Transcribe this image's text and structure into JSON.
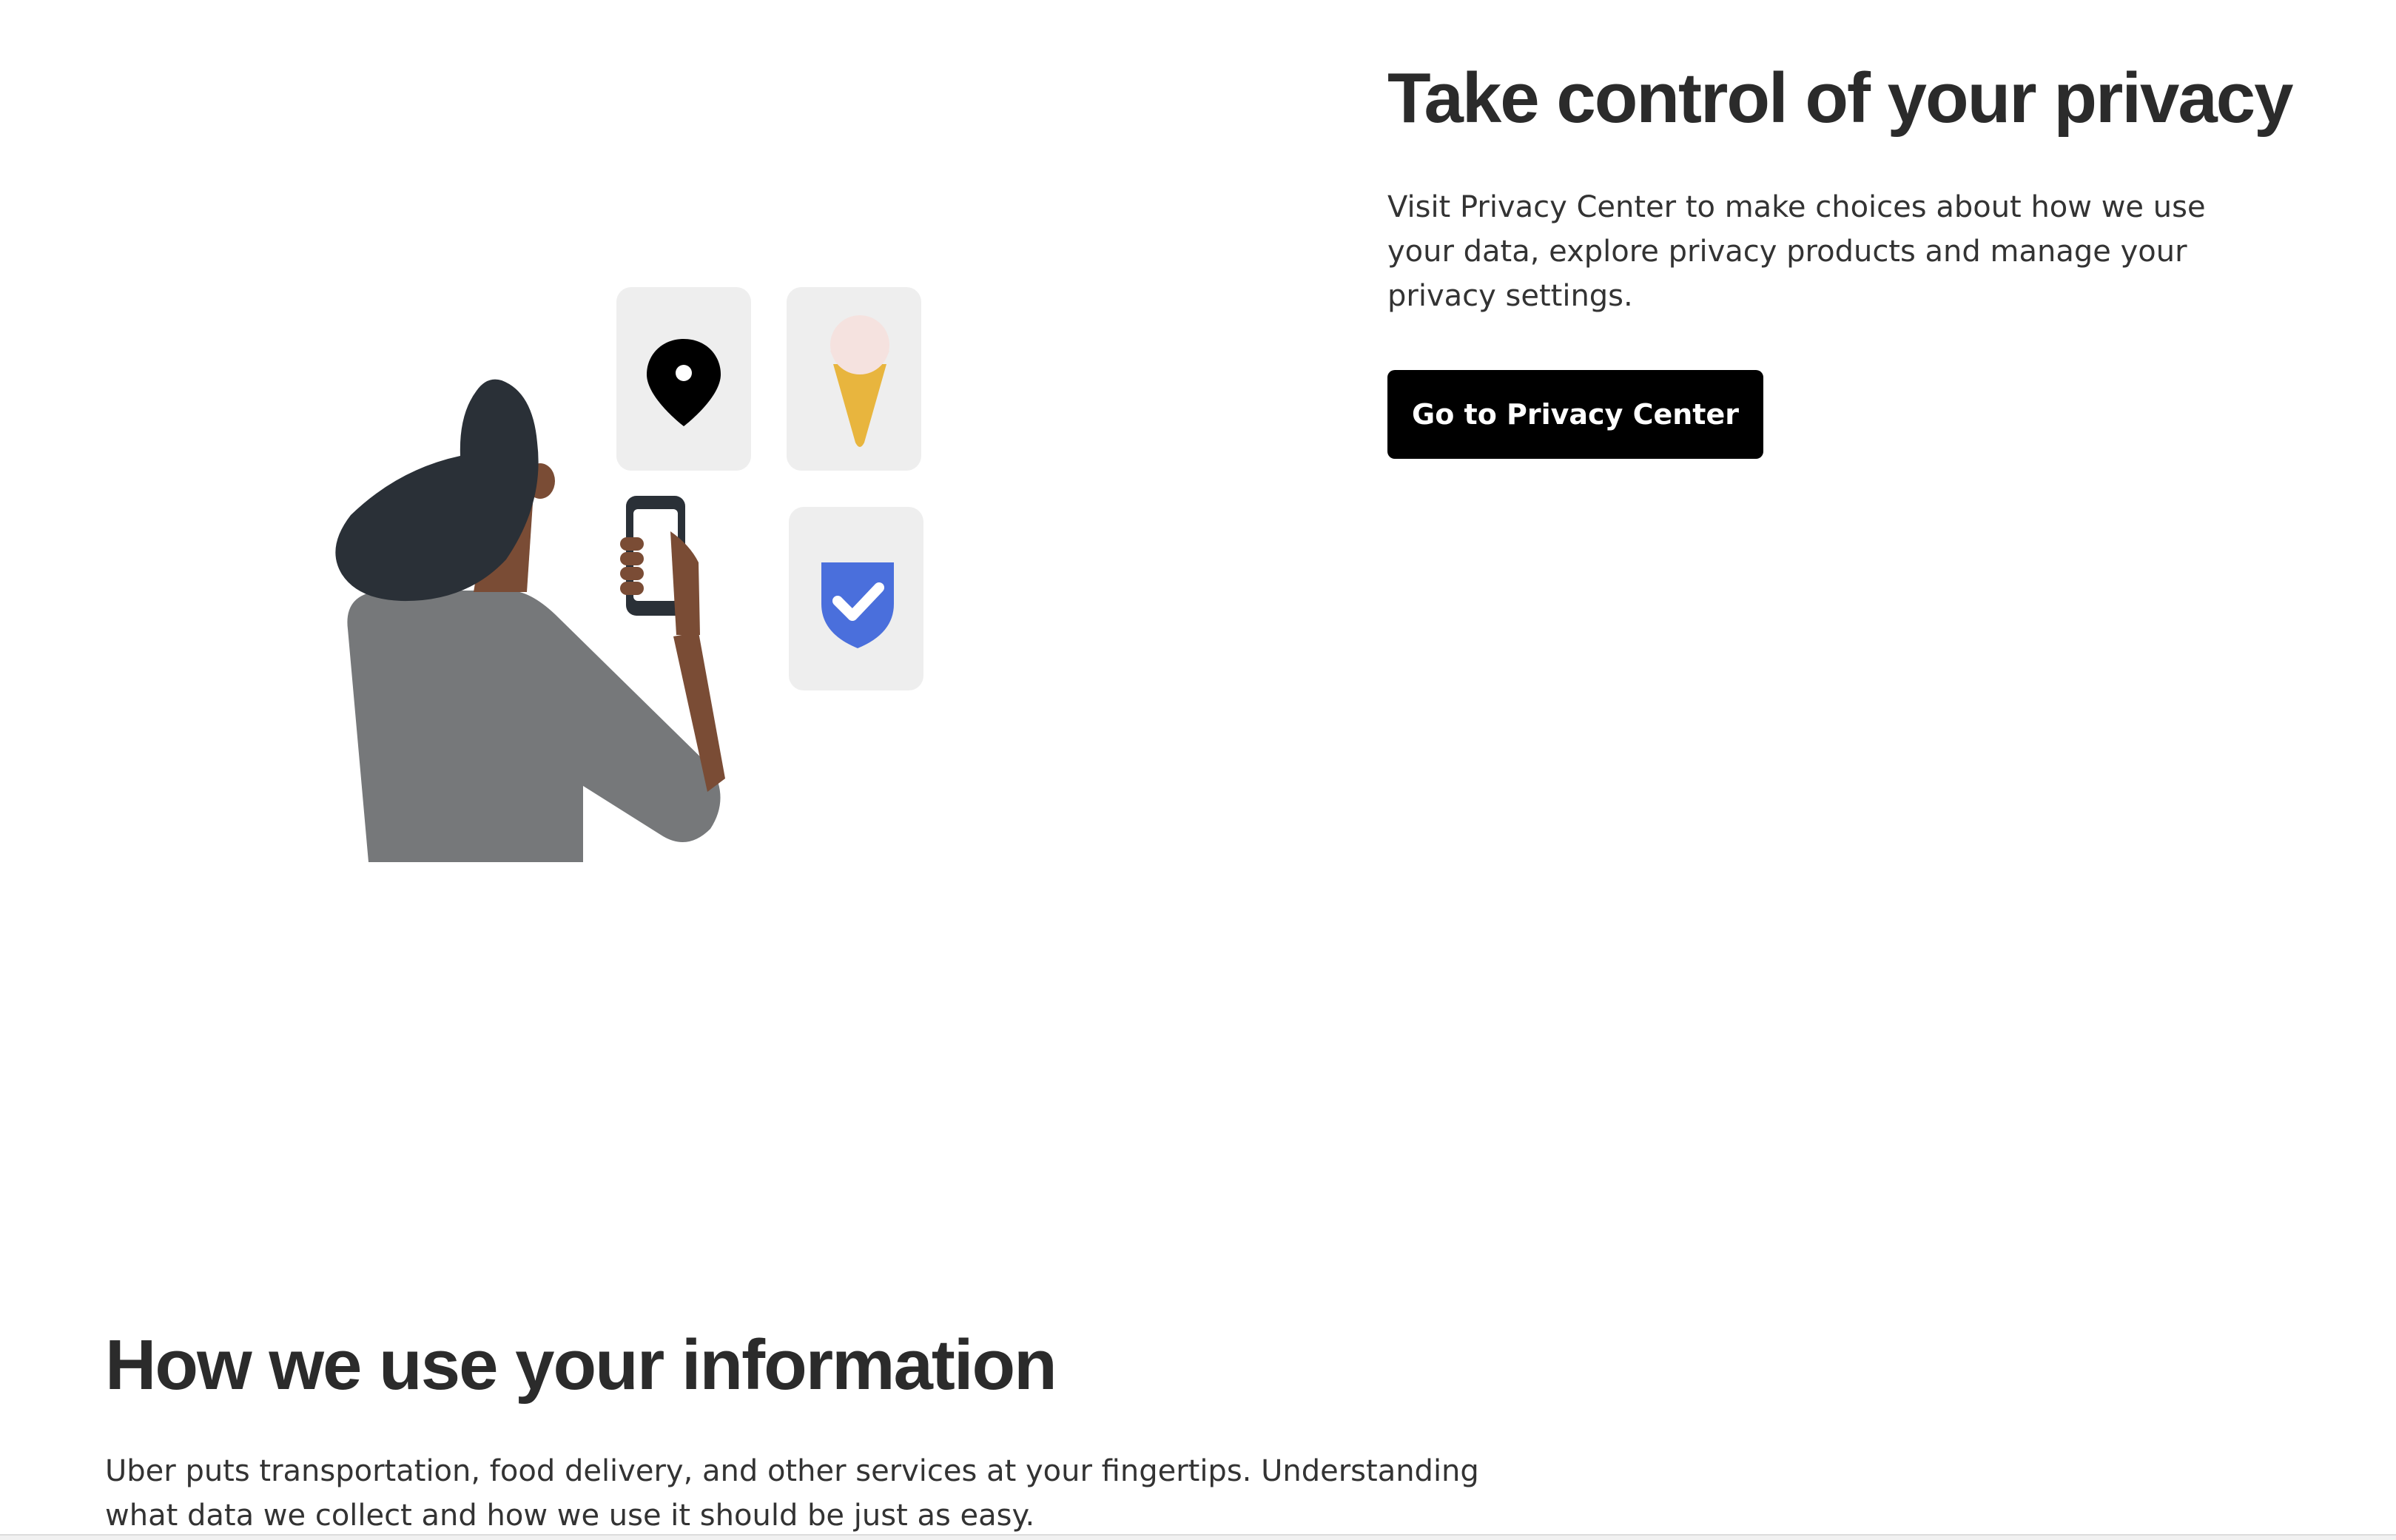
{
  "privacy": {
    "title": "Take control of your privacy",
    "body": "Visit Privacy Center to make choices about how we use your data, explore privacy products and manage your privacy settings.",
    "button_label": "Go to Privacy Center"
  },
  "info": {
    "title": "How we use your information",
    "body": "Uber puts transportation, food delivery, and other services at your fingertips. Understanding what data we collect and how we use it should be just as easy."
  },
  "illustration": {
    "icons": [
      "location-pin-icon",
      "ice-cream-icon",
      "shield-check-icon"
    ],
    "colors": {
      "card": "#eeeeee",
      "hair": "#2a3037",
      "skin": "#7a4c35",
      "shirt": "#76787a",
      "cone": "#e8b53e",
      "scoop": "#f5e2df",
      "shield": "#4a6fdc"
    }
  }
}
